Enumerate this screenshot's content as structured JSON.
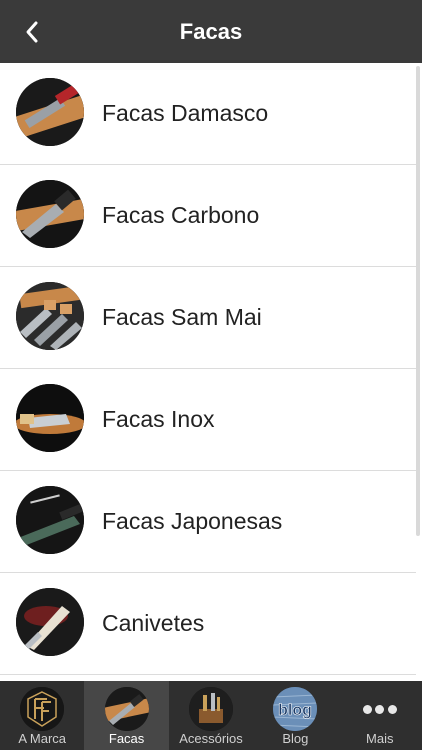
{
  "header": {
    "title": "Facas"
  },
  "list": {
    "items": [
      {
        "label": "Facas Damasco",
        "icon": "damascus-knife-thumbnail"
      },
      {
        "label": "Facas Carbono",
        "icon": "carbon-knife-thumbnail"
      },
      {
        "label": "Facas Sam Mai",
        "icon": "sam-mai-knives-thumbnail"
      },
      {
        "label": "Facas Inox",
        "icon": "stainless-knife-thumbnail"
      },
      {
        "label": "Facas Japonesas",
        "icon": "japanese-knife-thumbnail"
      },
      {
        "label": "Canivetes",
        "icon": "pocket-knife-thumbnail"
      }
    ]
  },
  "tabs": [
    {
      "label": "A Marca",
      "icon": "brand-logo-icon",
      "active": false
    },
    {
      "label": "Facas",
      "icon": "knife-icon",
      "active": true
    },
    {
      "label": "Acessórios",
      "icon": "accessories-icon",
      "active": false
    },
    {
      "label": "Blog",
      "icon": "blog-icon",
      "active": false
    },
    {
      "label": "Mais",
      "icon": "more-dots-icon",
      "active": false
    }
  ],
  "colors": {
    "topbar": "#3a3a3a",
    "tabbar": "#2f2f2f",
    "active_tab": "#474747"
  }
}
